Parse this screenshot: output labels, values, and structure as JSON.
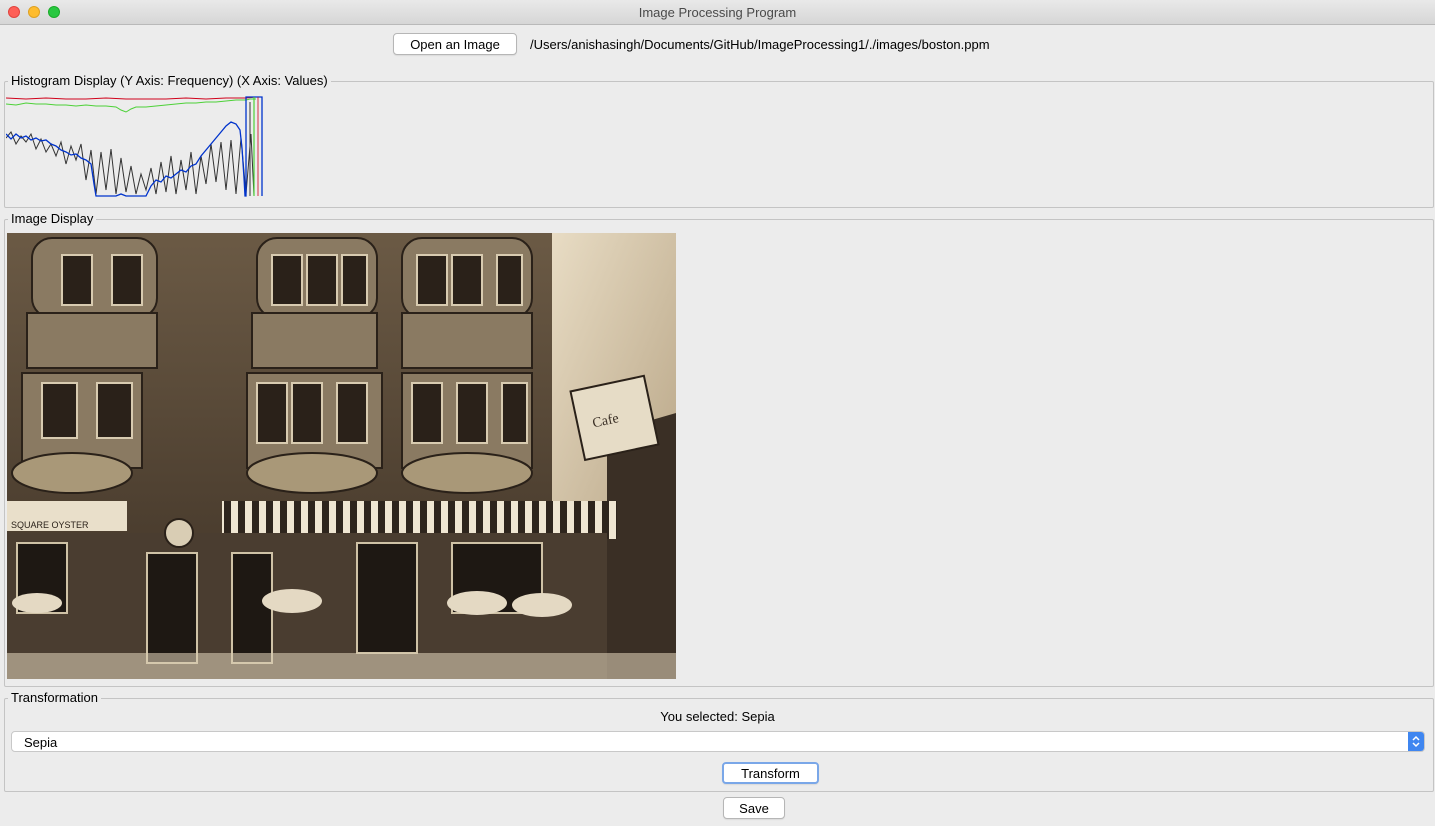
{
  "window": {
    "title": "Image Processing Program"
  },
  "toolbar": {
    "open_label": "Open an Image",
    "file_path": "/Users/anishasingh/Documents/GitHub/ImageProcessing1/./images/boston.ppm"
  },
  "histogram": {
    "legend": "Histogram Display (Y Axis: Frequency) (X Axis: Values)",
    "colors": {
      "red": "#d0021b",
      "green": "#4cd137",
      "blue": "#0033cc",
      "intensity": "#333333"
    }
  },
  "image_display": {
    "legend": "Image Display"
  },
  "transformation": {
    "legend": "Transformation",
    "selected_text": "You selected: Sepia",
    "dropdown_value": "Sepia",
    "transform_label": "Transform"
  },
  "footer": {
    "save_label": "Save"
  }
}
